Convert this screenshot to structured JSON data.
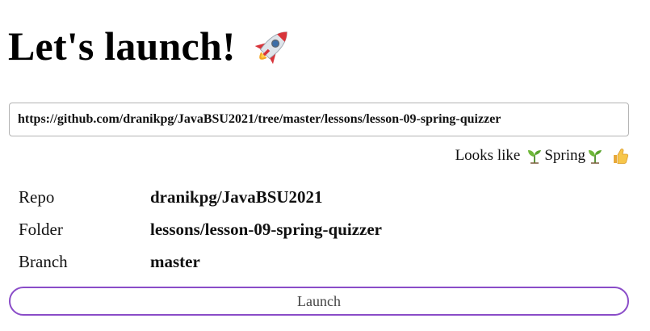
{
  "header": {
    "title": "Let's launch!",
    "icon": "rocket-icon"
  },
  "url_input": {
    "value": "https://github.com/dranikpg/JavaBSU2021/tree/master/lessons/lesson-09-spring-quizzer"
  },
  "detection": {
    "prefix": "Looks like",
    "framework": "Spring",
    "icons": [
      "sprout-icon",
      "sprout-icon",
      "thumbs-up-icon"
    ]
  },
  "info": {
    "repo_label": "Repo",
    "repo_value": "dranikpg/JavaBSU2021",
    "folder_label": "Folder",
    "folder_value": "lessons/lesson-09-spring-quizzer",
    "branch_label": "Branch",
    "branch_value": "master"
  },
  "launch_button": {
    "label": "Launch",
    "border_color": "#8a4cc8"
  }
}
